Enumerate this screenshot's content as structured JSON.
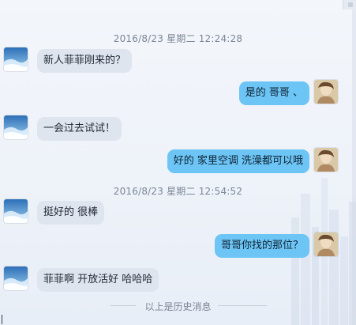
{
  "chat": {
    "timestamps": [
      "2016/8/23 星期二 12:24:28",
      "2016/8/23 星期二 12:54:52"
    ],
    "messages": [
      {
        "side": "in",
        "text": "新人菲菲刚来的？"
      },
      {
        "side": "out",
        "text": "是的 哥哥 、"
      },
      {
        "side": "in",
        "text": "一会过去试试！"
      },
      {
        "side": "out",
        "text": "好的 家里空调 洗澡都可以哦"
      },
      {
        "side": "in",
        "text": "挺好的 很棒"
      },
      {
        "side": "out",
        "text": "哥哥你找的那位？"
      },
      {
        "side": "in",
        "text": "菲菲啊 开放活好 哈哈哈"
      }
    ],
    "history_label": "以上是历史消息"
  },
  "icons": {
    "incoming_avatar": "sky-avatar-icon",
    "outgoing_avatar": "photo-avatar-icon"
  },
  "colors": {
    "incoming_bubble": "#dfe5ee",
    "outgoing_bubble": "#6cc5f5",
    "meta_text": "#7b8796"
  }
}
